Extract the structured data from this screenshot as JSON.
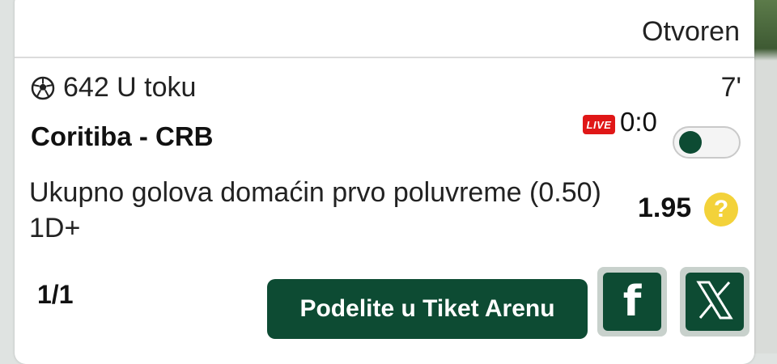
{
  "ticket": {
    "status": "Otvoren"
  },
  "match": {
    "event_line": "642 U toku",
    "minute": "7'",
    "teams": "Coritiba - CRB",
    "live_badge": "LIVE",
    "score": "0:0",
    "toggle_on": false
  },
  "bet": {
    "market": "Ukupno golova domaćin prvo poluvreme (0.50) 1D+",
    "odds": "1.95",
    "help_glyph": "?"
  },
  "footer": {
    "pager": "1/1",
    "share_label": "Podelite u Tiket Arenu",
    "facebook_glyph": "f"
  },
  "colors": {
    "brand_green": "#0d4b33",
    "live_red": "#e01717",
    "help_yellow": "#f3d23a"
  },
  "icons": [
    "soccer-ball-icon",
    "live-icon",
    "help-icon",
    "facebook-icon",
    "x-icon"
  ]
}
